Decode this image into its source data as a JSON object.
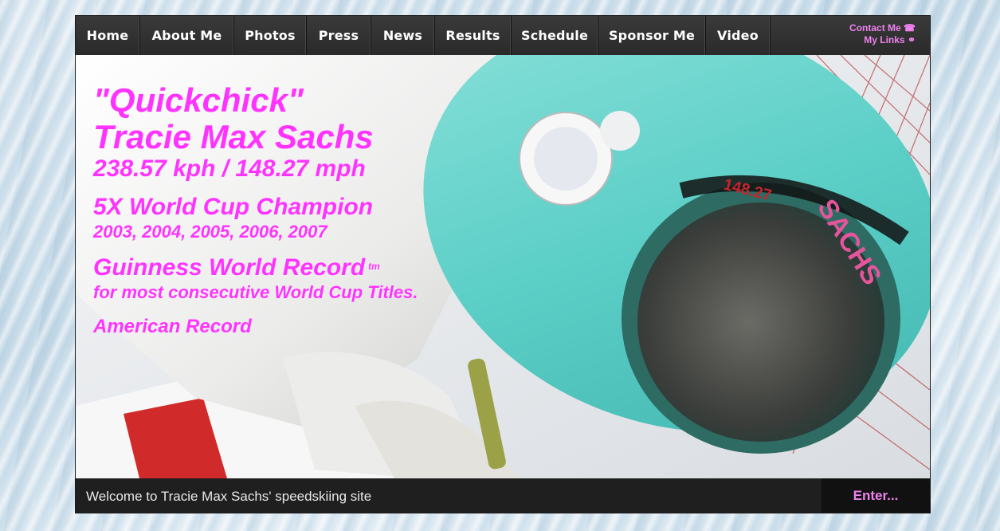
{
  "nav": {
    "items": [
      {
        "label": "Home"
      },
      {
        "label": "About Me"
      },
      {
        "label": "Photos"
      },
      {
        "label": "Press"
      },
      {
        "label": "News"
      },
      {
        "label": "Results"
      },
      {
        "label": "Schedule"
      },
      {
        "label": "Sponsor Me"
      },
      {
        "label": "Video"
      }
    ],
    "contact_label": "Contact Me",
    "links_label": "My Links",
    "contact_icon": "telephone-icon",
    "links_icon": "link-icon"
  },
  "hero": {
    "nickname": "\"Quickchick\"",
    "name": "Tracie Max Sachs",
    "speed": "238.57 kph / 148.27 mph",
    "champion": "5X World Cup Champion",
    "years": "2003, 2004, 2005, 2006, 2007",
    "guinness": "Guinness World Record",
    "tm": "tm",
    "guinness_desc": "for most consecutive World Cup Titles.",
    "american": "American Record",
    "helmet_speed": "148.27",
    "helmet_name": "SACHS"
  },
  "footer": {
    "welcome": "Welcome to Tracie Max Sachs' speedskiing site",
    "enter_label": "Enter..."
  },
  "colors": {
    "accent": "#ff33ff",
    "link": "#ee82ee",
    "nav_bg": "#2f2f2f",
    "helmet": "#6fd6cf"
  }
}
